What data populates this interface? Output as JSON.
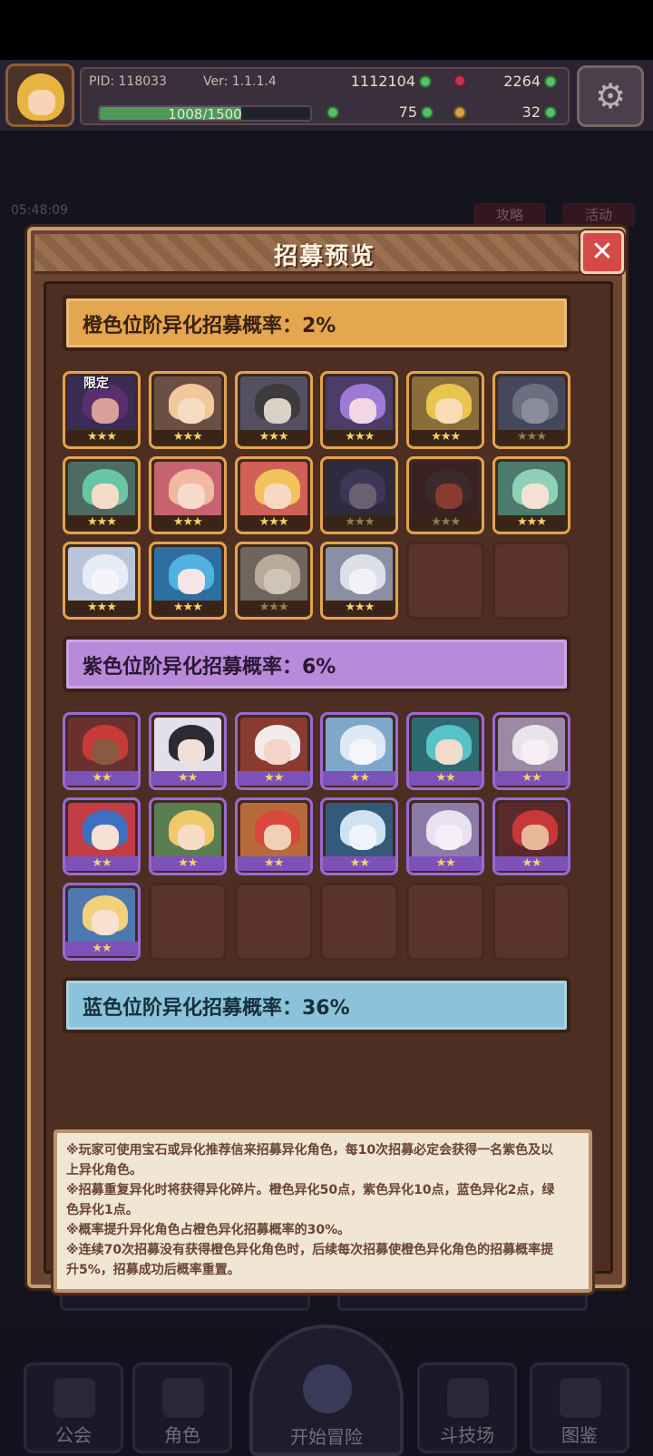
{
  "hud": {
    "pid": "PID: 118033",
    "version": "Ver: 1.1.1.4",
    "gold": "1112104",
    "gems": "2264",
    "xp_text": "1008/1500",
    "xp_fraction": 0.672,
    "clover": "75",
    "keys": "32"
  },
  "background": {
    "timer": "05:48:09",
    "tag_left": "攻略",
    "tag_right": "活动",
    "nav": [
      "公会",
      "角色",
      "开始冒险",
      "斗技场",
      "图鉴"
    ]
  },
  "modal": {
    "title": "招募预览",
    "close_icon": "close-icon",
    "orange_tier": {
      "label": "橙色位阶异化招募概率：2%",
      "color": "#e4a64f",
      "limited_label": "限定",
      "cards": [
        {
          "hair": "#5a2f6d",
          "face": "#d9a09a",
          "bg": "#3b2b55",
          "stars": "★★★",
          "dim": false
        },
        {
          "hair": "#f0c89a",
          "face": "#f7dcc4",
          "bg": "#6b4f44",
          "stars": "★★★",
          "dim": false
        },
        {
          "hair": "#3e3b3f",
          "face": "#d9d0c6",
          "bg": "#555060",
          "stars": "★★★",
          "dim": false
        },
        {
          "hair": "#9e7ad6",
          "face": "#f1d7e6",
          "bg": "#4b3d68",
          "stars": "★★★",
          "dim": false
        },
        {
          "hair": "#e9c44f",
          "face": "#f7dcb4",
          "bg": "#8a6d3a",
          "stars": "★★★",
          "dim": false
        },
        {
          "hair": "#6d6e80",
          "face": "#8c8d9c",
          "bg": "#45475a",
          "stars": "★★★",
          "dim": true
        },
        {
          "hair": "#68c6a5",
          "face": "#f5dcc8",
          "bg": "#4d6b62",
          "stars": "★★★",
          "dim": false
        },
        {
          "hair": "#f2b8a2",
          "face": "#f7dccb",
          "bg": "#c7636f",
          "stars": "★★★",
          "dim": false
        },
        {
          "hair": "#f1c35a",
          "face": "#f7d8c3",
          "bg": "#d06156",
          "stars": "★★★",
          "dim": false
        },
        {
          "hair": "#3d3656",
          "face": "#6b6070",
          "bg": "#2e2b3f",
          "stars": "★★★",
          "dim": true
        },
        {
          "hair": "#3a2a2a",
          "face": "#8a3b2f",
          "bg": "#3a2222",
          "stars": "★★★",
          "dim": true
        },
        {
          "hair": "#8fd1b8",
          "face": "#f5e0d4",
          "bg": "#4c7a6c",
          "stars": "★★★",
          "dim": false
        },
        {
          "hair": "#e6ecf5",
          "face": "#f4f4fa",
          "bg": "#b9c4d8",
          "stars": "★★★",
          "dim": false
        },
        {
          "hair": "#4fb2e2",
          "face": "#f4e6e6",
          "bg": "#2e6fa0",
          "stars": "★★★",
          "dim": false
        },
        {
          "hair": "#b8aa9a",
          "face": "#cfc4b8",
          "bg": "#6e655e",
          "stars": "★★★",
          "dim": true
        },
        {
          "hair": "#dcdfe8",
          "face": "#f2f2f6",
          "bg": "#8a8fa3",
          "stars": "★★★",
          "dim": false
        },
        {
          "empty": true
        },
        {
          "empty": true
        }
      ]
    },
    "purple_tier": {
      "label": "紫色位阶异化招募概率：6%",
      "color": "#b98ad9",
      "cards": [
        {
          "hair": "#c83a36",
          "face": "#8a5a40",
          "bg": "#6a3030",
          "stars": "★★"
        },
        {
          "hair": "#2c2a35",
          "face": "#f1e0d6",
          "bg": "#e4e0ea",
          "stars": "★★"
        },
        {
          "hair": "#f1ecea",
          "face": "#f4d4c8",
          "bg": "#8a3a2f",
          "stars": "★★"
        },
        {
          "hair": "#dfe9f5",
          "face": "#f4f6fa",
          "bg": "#7fa7c9",
          "stars": "★★"
        },
        {
          "hair": "#57c2c8",
          "face": "#f1dccb",
          "bg": "#2d6a70",
          "stars": "★★"
        },
        {
          "hair": "#e8e4ec",
          "face": "#f6eef2",
          "bg": "#9a8aa5",
          "stars": "★★"
        },
        {
          "hair": "#3e6fc0",
          "face": "#f5e0d4",
          "bg": "#c23d45",
          "stars": "★★"
        },
        {
          "hair": "#f1c86a",
          "face": "#f7dcc4",
          "bg": "#5b7d52",
          "stars": "★★"
        },
        {
          "hair": "#d8483c",
          "face": "#f2d0b6",
          "bg": "#b86a3a",
          "stars": "★★"
        },
        {
          "hair": "#cfe2f0",
          "face": "#eef4fa",
          "bg": "#345a7a",
          "stars": "★★"
        },
        {
          "hair": "#e8e2f0",
          "face": "#f6eef6",
          "bg": "#8c7aa8",
          "stars": "★★"
        },
        {
          "hair": "#c8383a",
          "face": "#e9b89a",
          "bg": "#5a2a2a",
          "stars": "★★"
        },
        {
          "hair": "#f1d27a",
          "face": "#f6e2cf",
          "bg": "#4f78b0",
          "stars": "★★"
        },
        {
          "empty": true
        },
        {
          "empty": true
        },
        {
          "empty": true
        },
        {
          "empty": true
        },
        {
          "empty": true
        }
      ]
    },
    "blue_tier": {
      "label": "蓝色位阶异化招募概率：36%",
      "color": "#8cc3db"
    },
    "notes": [
      "※玩家可使用宝石或异化推荐信来招募异化角色，每10次招募必定会获得一名紫色及以",
      "上异化角色。",
      "※招募重复异化时将获得异化碎片。橙色异化50点，紫色异化10点，蓝色异化2点，绿",
      "色异化1点。",
      "※概率提升异化角色占橙色异化招募概率的30%。",
      "※连续70次招募没有获得橙色异化角色时，后续每次招募使橙色异化角色的招募概率提",
      "升5%，招募成功后概率重置。"
    ]
  }
}
